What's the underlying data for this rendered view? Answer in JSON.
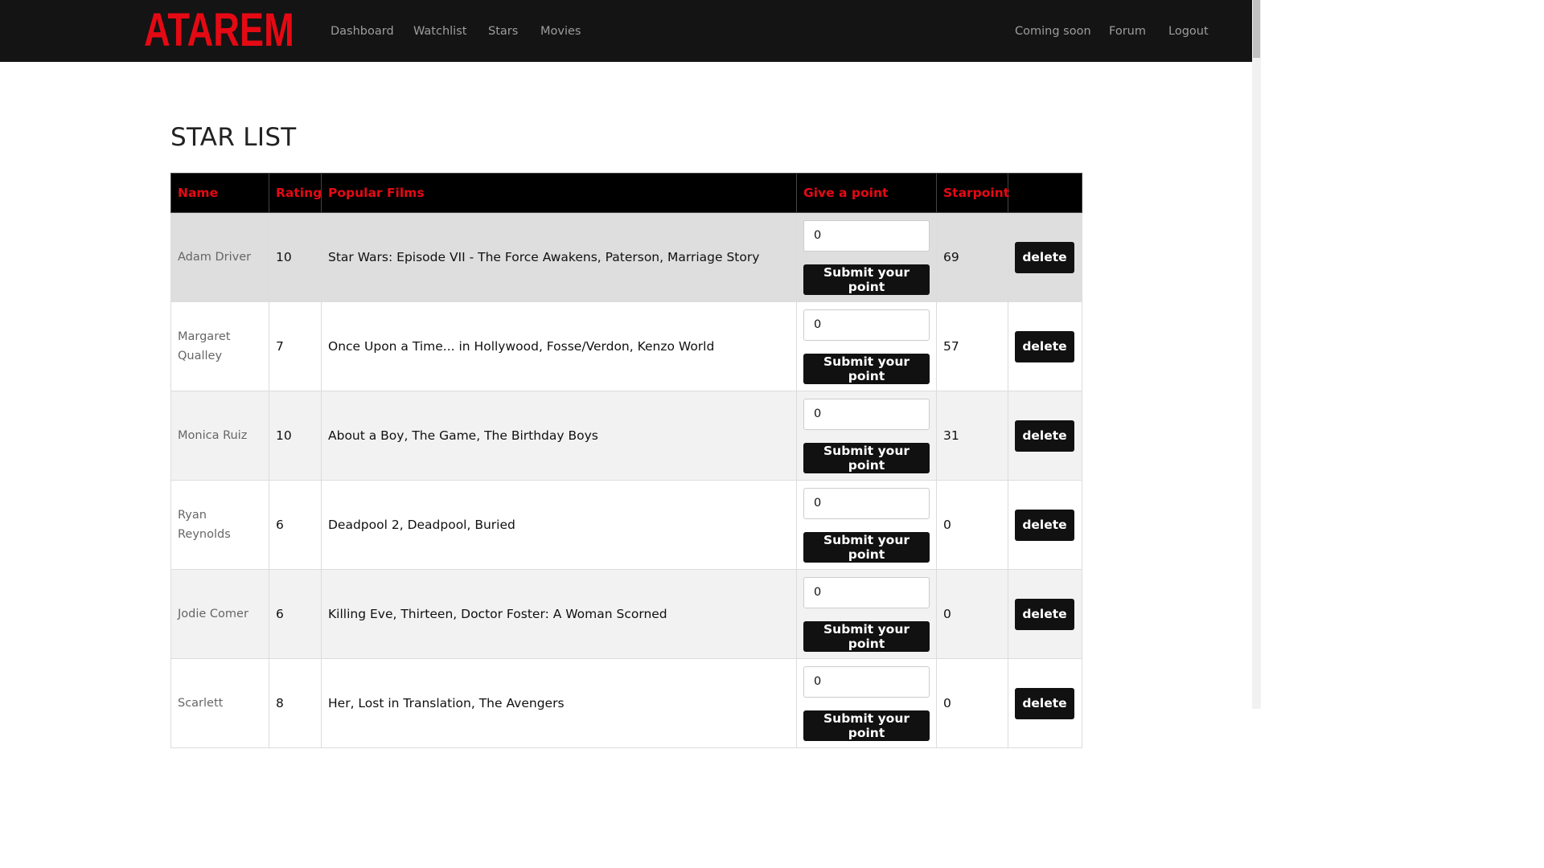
{
  "brand": {
    "logo_text": "ATAREM",
    "color": "#e50914"
  },
  "nav": {
    "left": [
      "Dashboard",
      "Watchlist",
      "Stars",
      "Movies"
    ],
    "right": [
      "Coming soon",
      "Forum",
      "Logout"
    ]
  },
  "page": {
    "title": "STAR LIST"
  },
  "table": {
    "headers": {
      "name": "Name",
      "rating": "Rating",
      "films": "Popular Films",
      "give": "Give a point",
      "starpoint": "Starpoint",
      "action": ""
    },
    "submit_label": "Submit your point",
    "delete_label": "delete",
    "rows": [
      {
        "name": "Adam Driver",
        "rating": "10",
        "films": "Star Wars: Episode VII - The Force Awakens, Paterson, Marriage Story",
        "point_value": "0",
        "starpoint": "69"
      },
      {
        "name": "Margaret Qualley",
        "rating": "7",
        "films": "Once Upon a Time... in Hollywood, Fosse/Verdon, Kenzo World",
        "point_value": "0",
        "starpoint": "57"
      },
      {
        "name": "Monica Ruiz",
        "rating": "10",
        "films": "About a Boy, The Game, The Birthday Boys",
        "point_value": "0",
        "starpoint": "31"
      },
      {
        "name": "Ryan Reynolds",
        "rating": "6",
        "films": "Deadpool 2, Deadpool, Buried",
        "point_value": "0",
        "starpoint": "0"
      },
      {
        "name": "Jodie Comer",
        "rating": "6",
        "films": "Killing Eve, Thirteen, Doctor Foster: A Woman Scorned",
        "point_value": "0",
        "starpoint": "0"
      },
      {
        "name": "Scarlett",
        "rating": "8",
        "films": "Her, Lost in Translation, The Avengers",
        "point_value": "0",
        "starpoint": "0"
      }
    ]
  }
}
